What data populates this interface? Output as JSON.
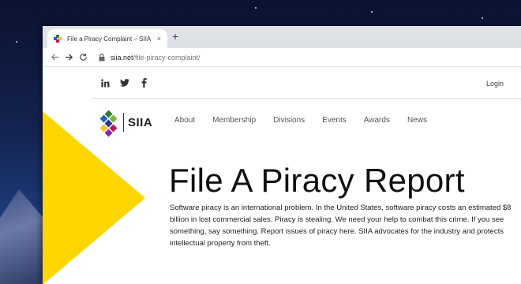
{
  "browser": {
    "tab_title": "File a Piracy Complaint – SIIA",
    "tab_close": "×",
    "new_tab": "+",
    "url_host": "siia.net",
    "url_path": "/file-piracy-complaint/"
  },
  "site": {
    "login": "Login",
    "logo_text": "SIIA",
    "nav": [
      "About",
      "Membership",
      "Divisions",
      "Events",
      "Awards",
      "News"
    ],
    "headline": "File A Piracy Report",
    "body": "Software piracy is an international problem. In the United States, software piracy costs an estimated $8 billion in lost commercial sales. Piracy is stealing. We need your help to combat this crime. If you see something, say something. Report issues of piracy here. SIIA advocates for the industry and protects intellectual property from theft.",
    "social_icons": [
      "linkedin-icon",
      "twitter-icon",
      "facebook-icon"
    ]
  },
  "colors": {
    "accent_yellow": "#ffd600",
    "tab_bar": "#dee1e6"
  }
}
